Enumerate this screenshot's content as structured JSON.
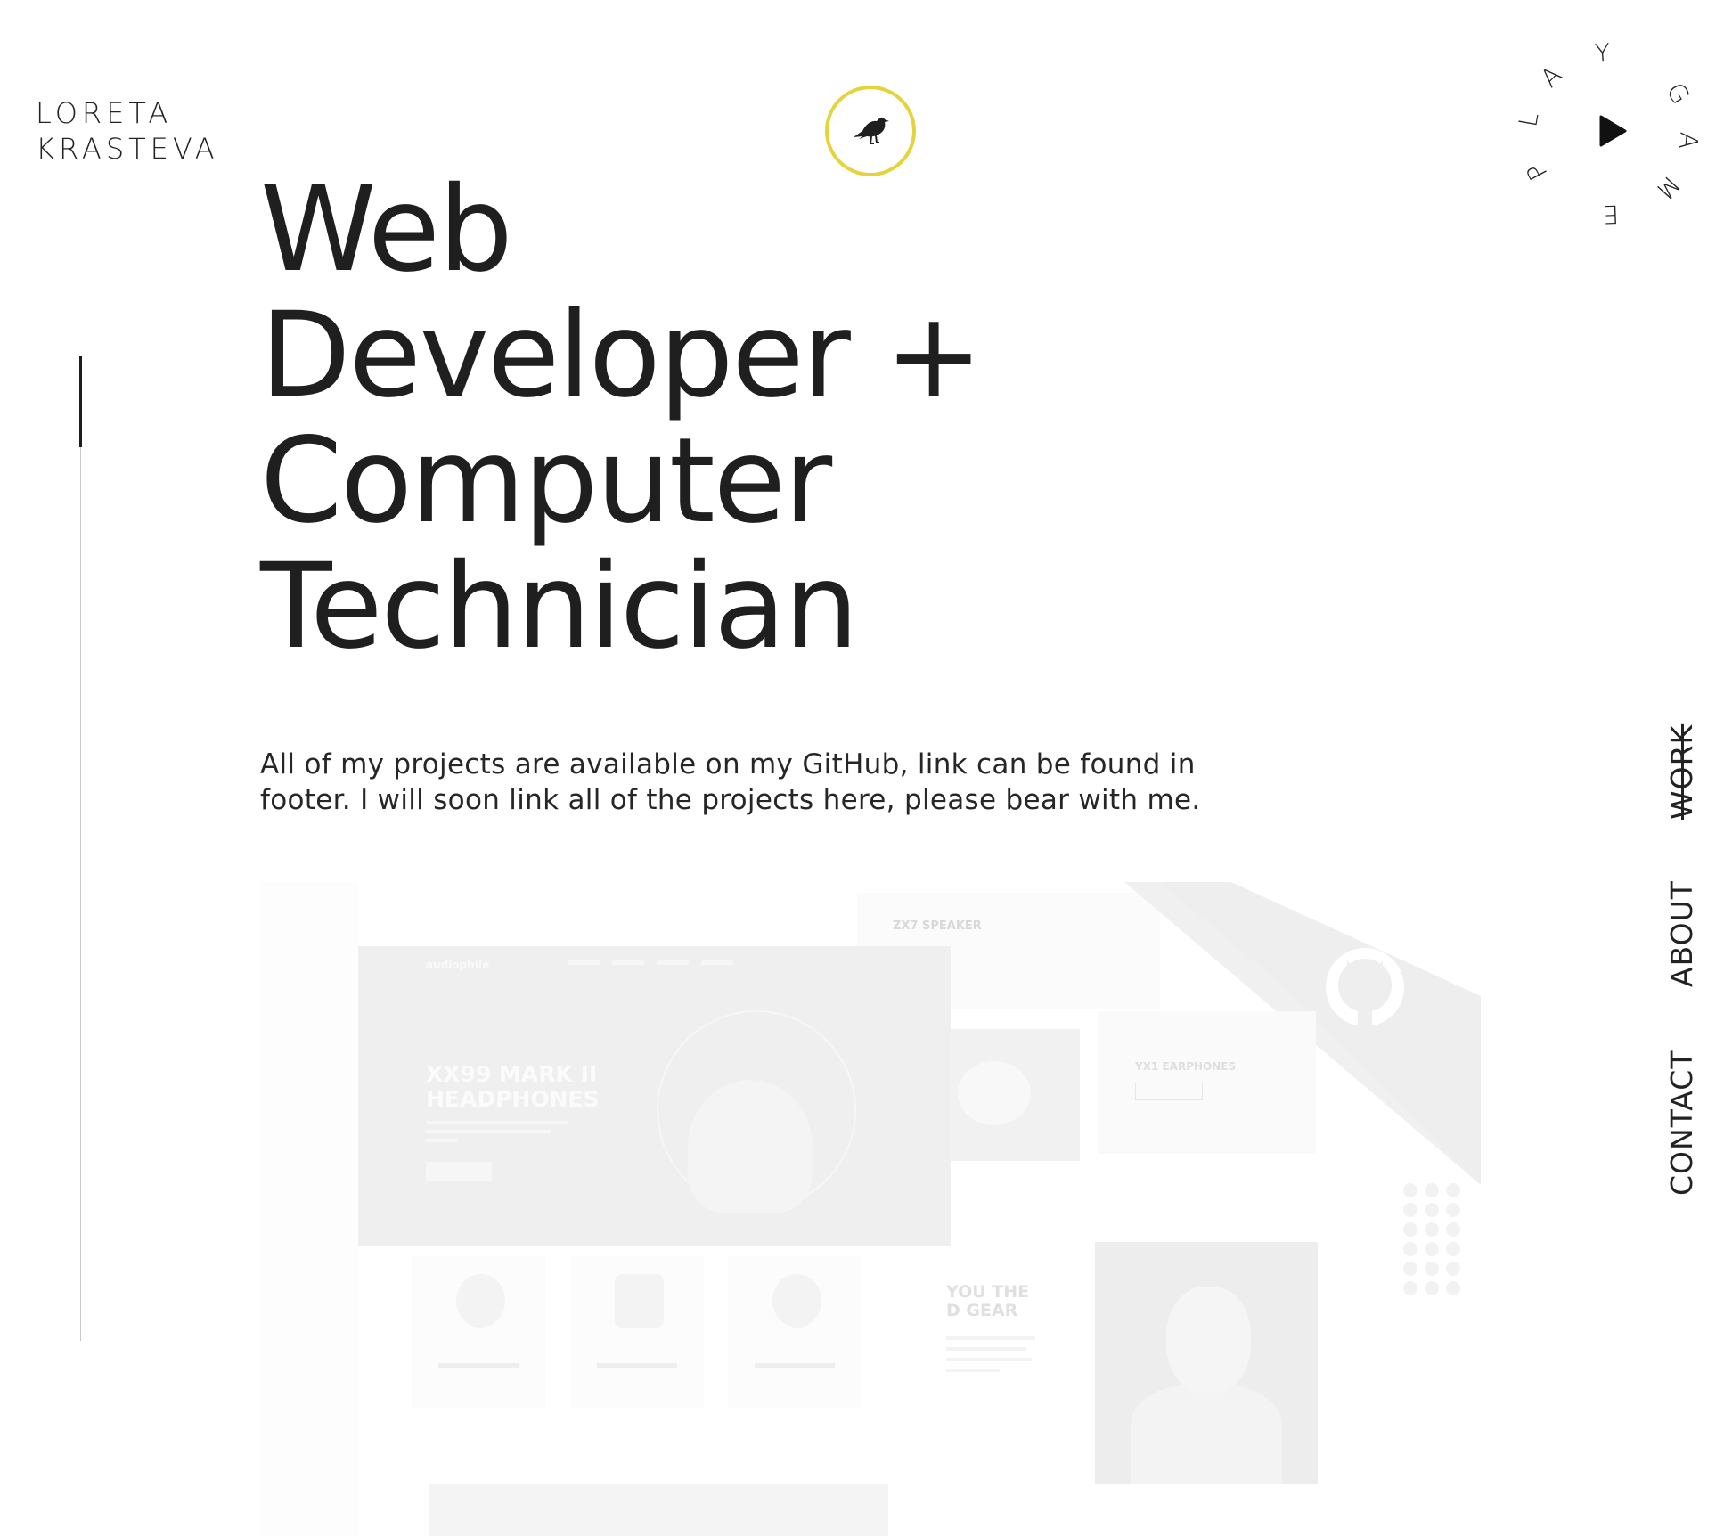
{
  "header": {
    "logo_line1": "LORETA",
    "logo_line2": "KRASTEVA",
    "bird_icon": "raven-icon",
    "accent_color": "#e4d33a"
  },
  "play_game": {
    "letters": [
      "P",
      "L",
      "A",
      "Y",
      "G",
      "A",
      "M",
      "E"
    ],
    "icon": "play-icon"
  },
  "hero": {
    "line1": "Web",
    "line2": "Developer +",
    "line3": "Computer",
    "line4": "Technician"
  },
  "intro": {
    "text": "All of my projects are available on my GitHub, link can be found in footer. I will soon link all of the projects here, please bear with me."
  },
  "nav": {
    "items": [
      {
        "label": "WORK",
        "active": true
      },
      {
        "label": "ABOUT",
        "active": false
      },
      {
        "label": "CONTACT",
        "active": false
      }
    ]
  },
  "preview": {
    "main_logo": "audiophile",
    "main_headline_1": "XX99 MARK II",
    "main_headline_2": "HEADPHONES",
    "speaker_label": "ZX7 SPEAKER",
    "earphones_label": "YX1 EARPHONES",
    "gear_line1": "YOU THE",
    "gear_line2": "D GEAR",
    "github_icon": "github-icon"
  }
}
